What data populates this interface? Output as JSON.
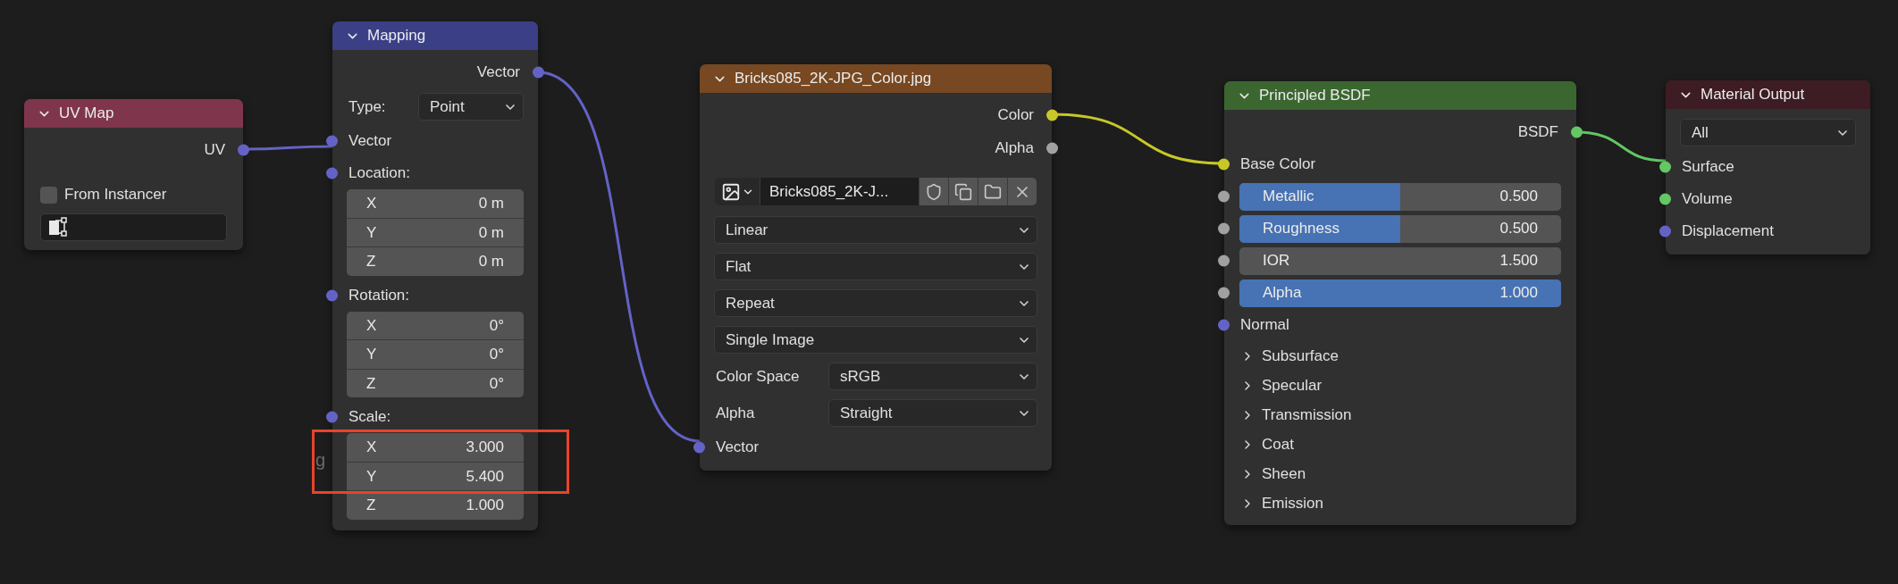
{
  "nodes": [
    {
      "title": "UV Map",
      "color": "#7f364d",
      "expanded": true,
      "rows": [
        {
          "kind": "output",
          "label": "UV",
          "color": "#6363c7"
        },
        {
          "kind": "checkbox",
          "label": "From Instancer",
          "checked": false
        },
        {
          "kind": "object_field"
        }
      ]
    },
    {
      "title": "Mapping",
      "color": "#3b3f86",
      "expanded": true,
      "rows": [
        {
          "kind": "output",
          "label": "Vector",
          "color": "#6363c7"
        },
        {
          "kind": "prop_select",
          "label": "Type:",
          "value": "Point"
        },
        {
          "kind": "input",
          "label": "Vector",
          "color": "#6363c7"
        },
        {
          "kind": "input",
          "label": "Location:",
          "color": "#6363c7"
        },
        {
          "kind": "vector",
          "items": [
            {
              "axis": "X",
              "value": "0 m"
            },
            {
              "axis": "Y",
              "value": "0 m"
            },
            {
              "axis": "Z",
              "value": "0 m"
            }
          ]
        },
        {
          "kind": "input",
          "label": "Rotation:",
          "color": "#6363c7"
        },
        {
          "kind": "vector",
          "items": [
            {
              "axis": "X",
              "value": "0°"
            },
            {
              "axis": "Y",
              "value": "0°"
            },
            {
              "axis": "Z",
              "value": "0°"
            }
          ]
        },
        {
          "kind": "input",
          "label": "Scale:",
          "color": "#6363c7"
        },
        {
          "kind": "vector",
          "items": [
            {
              "axis": "X",
              "value": "3.000"
            },
            {
              "axis": "Y",
              "value": "5.400"
            },
            {
              "axis": "Z",
              "value": "1.000"
            }
          ]
        }
      ]
    },
    {
      "title": "Bricks085_2K-JPG_Color.jpg",
      "color": "#774821",
      "expanded": true,
      "rows": [
        {
          "kind": "output",
          "label": "Color",
          "color": "#c7c729"
        },
        {
          "kind": "output",
          "label": "Alpha",
          "color": "#a1a1a1"
        },
        {
          "kind": "image_picker",
          "name": "Bricks085_2K-J..."
        },
        {
          "kind": "select",
          "value": "Linear"
        },
        {
          "kind": "select",
          "value": "Flat"
        },
        {
          "kind": "select",
          "value": "Repeat"
        },
        {
          "kind": "select",
          "value": "Single Image"
        },
        {
          "kind": "prop_select",
          "label": "Color Space",
          "value": "sRGB"
        },
        {
          "kind": "prop_select",
          "label": "Alpha",
          "value": "Straight"
        },
        {
          "kind": "input",
          "label": "Vector",
          "color": "#6363c7"
        }
      ]
    },
    {
      "title": "Principled BSDF",
      "color": "#3b6630",
      "expanded": true,
      "rows": [
        {
          "kind": "output",
          "label": "BSDF",
          "color": "#63c763"
        },
        {
          "kind": "input",
          "label": "Base Color",
          "color": "#c7c729"
        },
        {
          "kind": "slider",
          "label": "Metallic",
          "value": "0.500",
          "level": 0.5,
          "color": "#a1a1a1"
        },
        {
          "kind": "slider",
          "label": "Roughness",
          "value": "0.500",
          "level": 0.5,
          "color": "#a1a1a1"
        },
        {
          "kind": "number",
          "label": "IOR",
          "value": "1.500",
          "color": "#a1a1a1"
        },
        {
          "kind": "slider",
          "label": "Alpha",
          "value": "1.000",
          "level": 1,
          "color": "#a1a1a1"
        },
        {
          "kind": "input",
          "label": "Normal",
          "color": "#6363c7"
        },
        {
          "kind": "panel",
          "label": "Subsurface",
          "expanded": false
        },
        {
          "kind": "panel",
          "label": "Specular",
          "expanded": false
        },
        {
          "kind": "panel",
          "label": "Transmission",
          "expanded": false
        },
        {
          "kind": "panel",
          "label": "Coat",
          "expanded": false
        },
        {
          "kind": "panel",
          "label": "Sheen",
          "expanded": false
        },
        {
          "kind": "panel",
          "label": "Emission",
          "expanded": false
        }
      ]
    },
    {
      "title": "Material Output",
      "color": "#3d1c24",
      "expanded": true,
      "rows": [
        {
          "kind": "select",
          "value": "All"
        },
        {
          "kind": "input",
          "label": "Surface",
          "color": "#63c763"
        },
        {
          "kind": "input",
          "label": "Volume",
          "color": "#63c763"
        },
        {
          "kind": "input",
          "label": "Displacement",
          "color": "#6363c7"
        }
      ]
    }
  ],
  "stray_text": "g"
}
